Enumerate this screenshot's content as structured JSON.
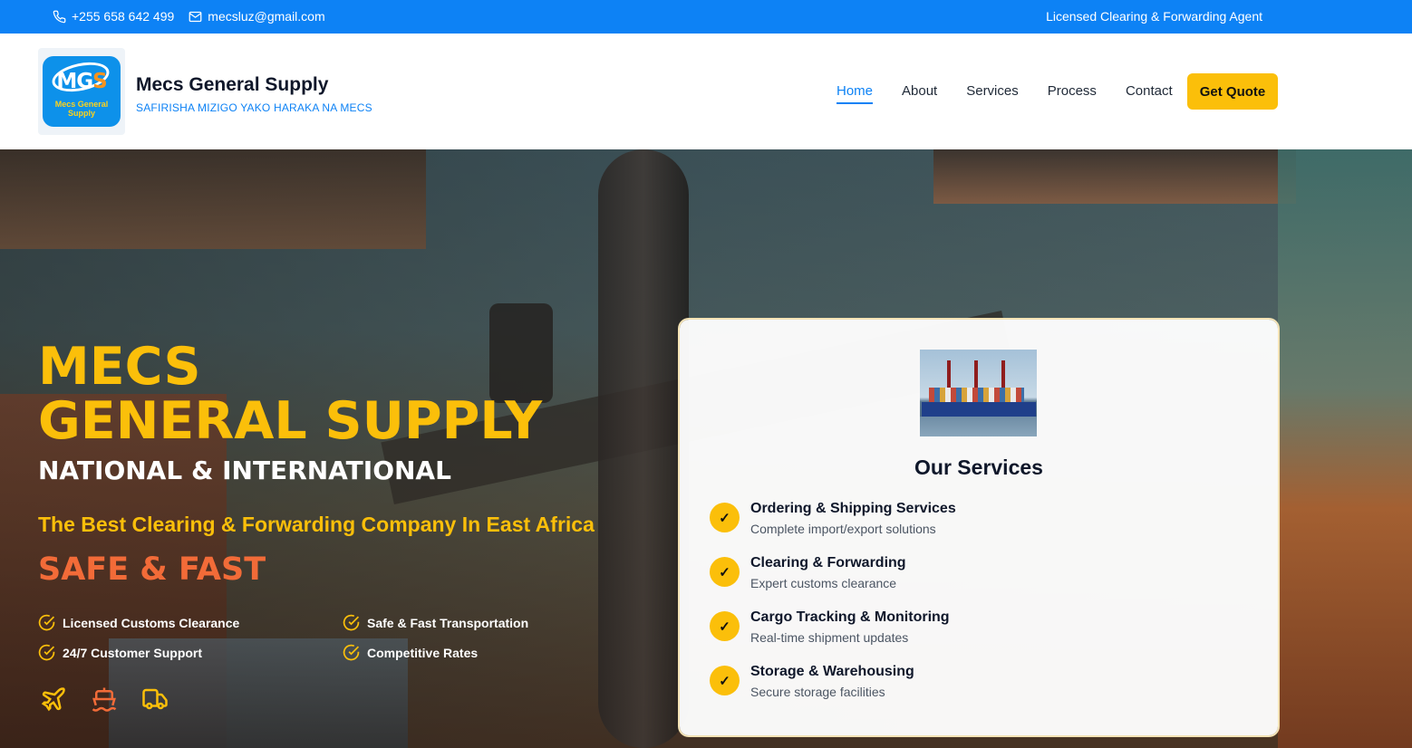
{
  "topbar": {
    "phone": "+255 658 642 499",
    "email": "mecsluz@gmail.com",
    "tagline": "Licensed Clearing & Forwarding Agent",
    "phone_icon": "phone-icon",
    "email_icon": "mail-icon"
  },
  "header": {
    "logo": {
      "mark": "MG",
      "mark_accent": "S",
      "sub_line1": "Mecs General",
      "sub_line2": "Supply"
    },
    "brand_name": "Mecs General Supply",
    "brand_tagline": "SAFIRISHA MIZIGO YAKO HARAKA NA MECS",
    "nav": [
      {
        "label": "Home",
        "active": true
      },
      {
        "label": "About",
        "active": false
      },
      {
        "label": "Services",
        "active": false
      },
      {
        "label": "Process",
        "active": false
      },
      {
        "label": "Contact",
        "active": false
      }
    ],
    "cta_label": "Get Quote"
  },
  "hero": {
    "title_line1": "MECS",
    "title_line2": "GENERAL SUPPLY",
    "subtitle": "NATIONAL & INTERNATIONAL",
    "tagline": "The Best Clearing & Forwarding Company In East Africa",
    "slogan": "SAFE & FAST",
    "features": [
      "Licensed Customs Clearance",
      "Safe & Fast Transportation",
      "24/7 Customer Support",
      "Competitive Rates"
    ],
    "transport_icons": [
      "plane-icon",
      "ship-icon",
      "truck-icon"
    ]
  },
  "services_card": {
    "title": "Our Services",
    "items": [
      {
        "name": "Ordering & Shipping Services",
        "desc": "Complete import/export solutions"
      },
      {
        "name": "Clearing & Forwarding",
        "desc": "Expert customs clearance"
      },
      {
        "name": "Cargo Tracking & Monitoring",
        "desc": "Real-time shipment updates"
      },
      {
        "name": "Storage & Warehousing",
        "desc": "Secure storage facilities"
      }
    ],
    "check_glyph": "✓"
  },
  "colors": {
    "primary_blue": "#0d82f5",
    "accent_yellow": "#fbbf0a",
    "accent_orange": "#f26b38"
  }
}
